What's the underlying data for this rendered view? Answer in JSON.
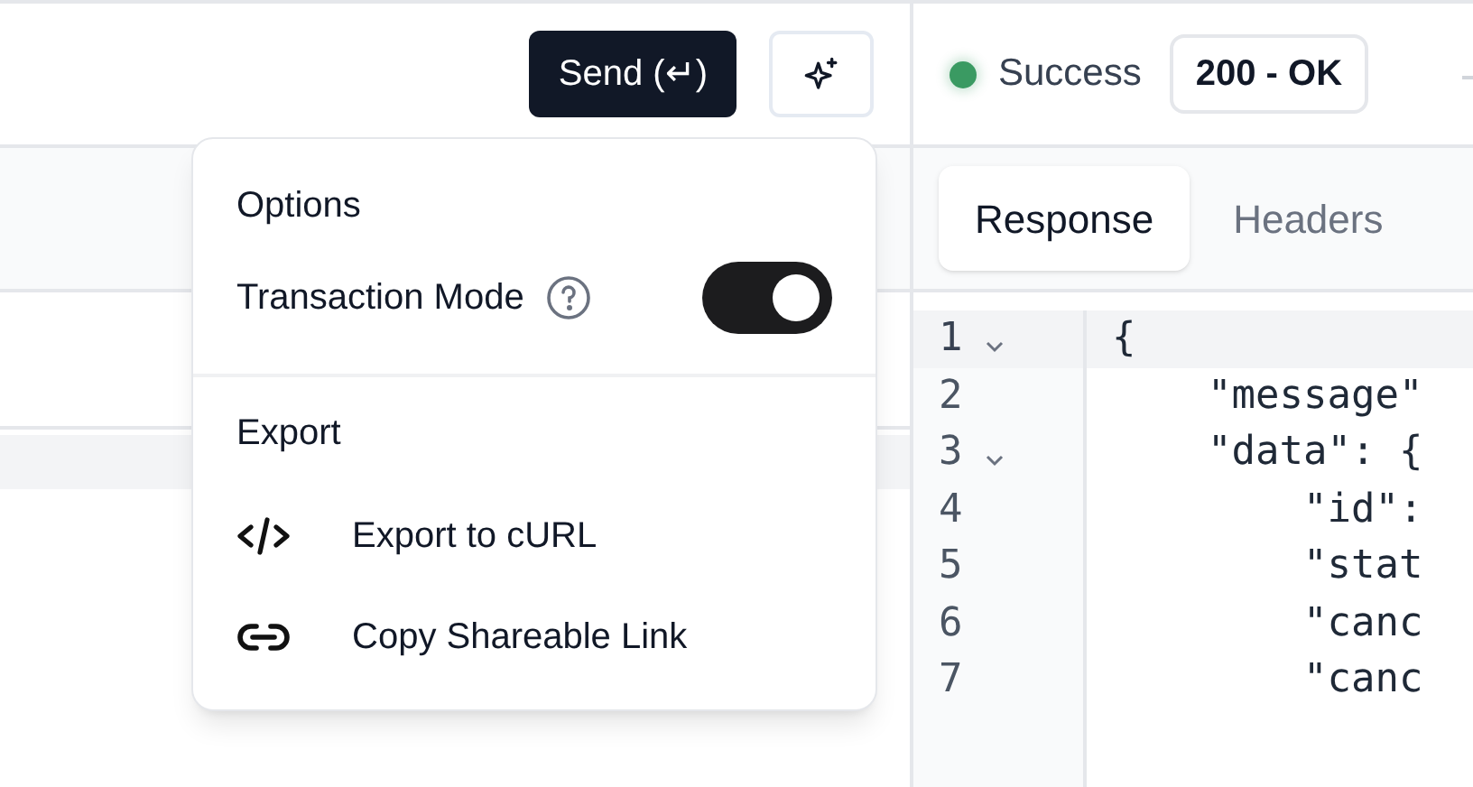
{
  "send_button": {
    "label": "Send (↵)"
  },
  "status": {
    "label": "Success",
    "color": "#3a9a62",
    "code": "200 - OK"
  },
  "response_tabs": [
    {
      "label": "Response",
      "selected": true
    },
    {
      "label": "Headers",
      "selected": false
    }
  ],
  "code_lines": [
    {
      "number": "1",
      "text": "{",
      "foldable": true,
      "highlighted": true
    },
    {
      "number": "2",
      "text": "    \"message\"",
      "foldable": false,
      "highlighted": false
    },
    {
      "number": "3",
      "text": "    \"data\": {",
      "foldable": true,
      "highlighted": false
    },
    {
      "number": "4",
      "text": "        \"id\":",
      "foldable": false,
      "highlighted": false
    },
    {
      "number": "5",
      "text": "        \"stat",
      "foldable": false,
      "highlighted": false
    },
    {
      "number": "6",
      "text": "        \"canc",
      "foldable": false,
      "highlighted": false
    },
    {
      "number": "7",
      "text": "        \"canc",
      "foldable": false,
      "highlighted": false
    }
  ],
  "menu": {
    "sections": [
      {
        "title": "Options",
        "items": [
          {
            "kind": "toggle",
            "label": "Transaction Mode",
            "on": true
          }
        ]
      },
      {
        "title": "Export",
        "items": [
          {
            "kind": "code",
            "label": "Export to cURL"
          },
          {
            "kind": "link",
            "label": "Copy Shareable Link"
          }
        ]
      }
    ]
  }
}
